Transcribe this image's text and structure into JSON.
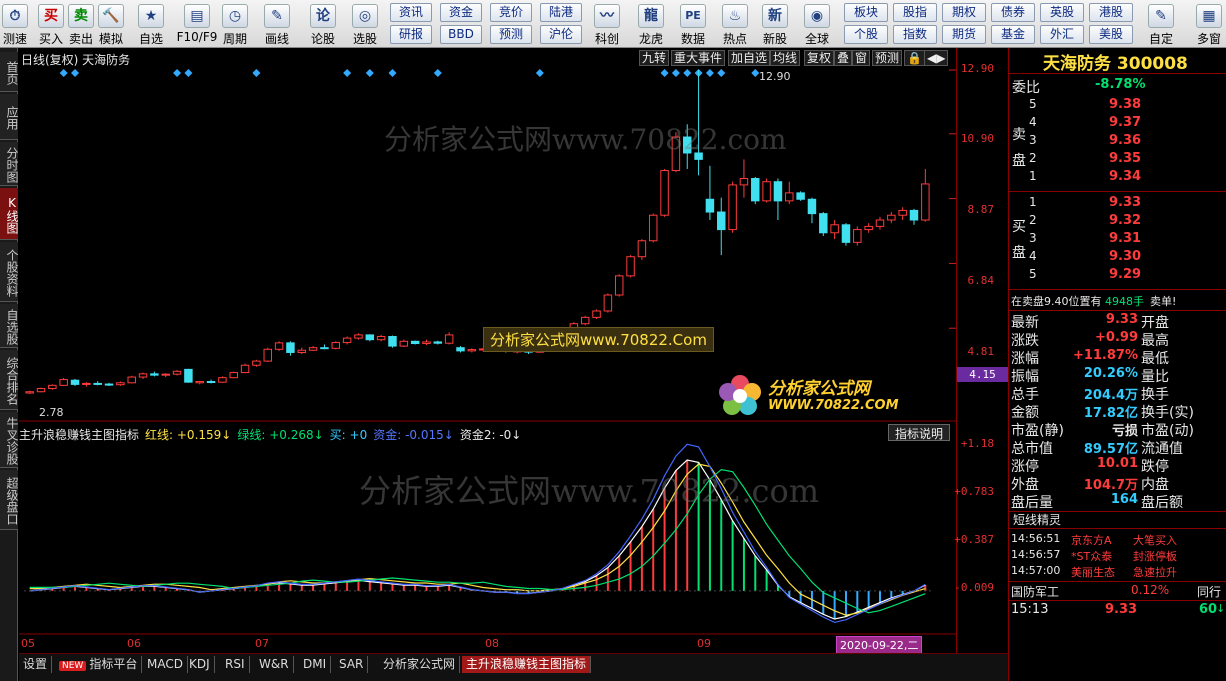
{
  "toolbar": {
    "items": [
      {
        "label": "测速",
        "icon": "speed-icon",
        "glyph": "⏱"
      },
      {
        "label": "买入",
        "icon": "buy-icon",
        "glyph": "买"
      },
      {
        "label": "卖出",
        "icon": "sell-icon",
        "glyph": "卖"
      },
      {
        "label": "模拟",
        "icon": "hammer-icon",
        "glyph": "🔨"
      },
      {
        "label": "自选",
        "icon": "star-icon",
        "glyph": "★"
      },
      {
        "label": "F10/F9",
        "icon": "f10-icon",
        "glyph": "▤"
      },
      {
        "label": "周期",
        "icon": "clock-icon",
        "glyph": "◷"
      },
      {
        "label": "画线",
        "icon": "pen-icon",
        "glyph": "✎"
      },
      {
        "label": "论股",
        "icon": "discuss-icon",
        "glyph": "论"
      },
      {
        "label": "选股",
        "icon": "select-icon",
        "glyph": "◎"
      }
    ],
    "group1": [
      [
        "资讯",
        "资金",
        "竞价",
        "陆港"
      ],
      [
        "研报",
        "BBD",
        "预测",
        "沪伦"
      ]
    ],
    "items2": [
      {
        "label": "科创",
        "icon": "chart-icon",
        "glyph": "〰"
      },
      {
        "label": "龙虎",
        "icon": "dragon-icon",
        "glyph": "龍"
      },
      {
        "label": "数据",
        "icon": "pe-icon",
        "glyph": "PE"
      },
      {
        "label": "热点",
        "icon": "fire-icon",
        "glyph": "♨"
      },
      {
        "label": "新股",
        "icon": "new-stock-icon",
        "glyph": "新"
      },
      {
        "label": "全球",
        "icon": "globe-icon",
        "glyph": "◉"
      }
    ],
    "group2": [
      [
        "板块",
        "股指",
        "期权",
        "债券",
        "英股",
        "港股"
      ],
      [
        "个股",
        "指数",
        "期货",
        "基金",
        "外汇",
        "美股"
      ]
    ],
    "items3": [
      {
        "label": "自定",
        "icon": "custom-icon",
        "glyph": "✎"
      },
      {
        "label": "多窗",
        "icon": "multiwin-icon",
        "glyph": "▦"
      }
    ]
  },
  "leftnav": [
    "首页",
    "应用",
    "分时图",
    "K线图",
    "个股资料",
    "自选股",
    "综合排名",
    "牛叉诊股",
    "超级盘口"
  ],
  "chart": {
    "header": "日线(复权) 天海防务",
    "top_buttons": [
      "九转",
      "重大事件",
      "加自选",
      "均线",
      "复权",
      "叠",
      "窗",
      "预测"
    ],
    "high_label": "12.90",
    "low_label": "2.78",
    "indicator_line": [
      {
        "text": "主升浪稳赚钱主图指标",
        "color": "#e8e8e8"
      },
      {
        "text": "红线: +0.159↓",
        "color": "#ffe044"
      },
      {
        "text": "绿线: +0.268↓",
        "color": "#00e070"
      },
      {
        "text": "买: +0",
        "color": "#33ccff"
      },
      {
        "text": "资金: -0.015↓",
        "color": "#5577ff"
      },
      {
        "text": "资金2: -0↓",
        "color": "#e8e8e8"
      }
    ],
    "indicator_help": "指标说明",
    "watermark": "分析家公式网www.70822.com",
    "banner": "分析家公式网www.70822.Com",
    "logo_text": "分析家公式网",
    "logo_url": "WWW.70822.COM",
    "date_labels": [
      "05",
      "06",
      "07",
      "08",
      "09"
    ],
    "crosshair_date": "2020-09-22,二",
    "price_axis": [
      "12.90",
      "10.90",
      "8.87",
      "6.84",
      "4.81",
      "4.15"
    ],
    "ind_axis": [
      "+1.18",
      "+0.783",
      "+0.387",
      "-0.009"
    ]
  },
  "right": {
    "title": "天海防务 300008",
    "weibi_label": "委比",
    "weibi": "-8.78%",
    "sell_label": "卖盘",
    "buy_label": "买盘",
    "sells": [
      [
        "5",
        "9.38"
      ],
      [
        "4",
        "9.37"
      ],
      [
        "3",
        "9.36"
      ],
      [
        "2",
        "9.35"
      ],
      [
        "1",
        "9.34"
      ]
    ],
    "buys": [
      [
        "1",
        "9.33"
      ],
      [
        "2",
        "9.32"
      ],
      [
        "3",
        "9.31"
      ],
      [
        "4",
        "9.30"
      ],
      [
        "5",
        "9.29"
      ]
    ],
    "notice": "在卖盘9.40位置有",
    "notice_val": "4948手",
    "notice_tail": "卖单!",
    "stats": [
      [
        "最新",
        "9.33",
        "开盘"
      ],
      [
        "涨跌",
        "+0.99",
        "最高"
      ],
      [
        "涨幅",
        "+11.87%",
        "最低"
      ],
      [
        "振幅",
        "20.26%",
        "量比"
      ],
      [
        "总手",
        "204.4万",
        "换手"
      ],
      [
        "金额",
        "17.82亿",
        "换手(实)"
      ],
      [
        "市盈(静)",
        "亏损",
        "市盈(动)"
      ],
      [
        "总市值",
        "89.57亿",
        "流通值"
      ],
      [
        "涨停",
        "10.01",
        "跌停"
      ],
      [
        "外盘",
        "104.7万",
        "内盘"
      ],
      [
        "盘后量",
        "164",
        "盘后额"
      ]
    ],
    "jingling_title": "短线精灵",
    "jingling": [
      [
        "14:56:51",
        "京东方A",
        "大笔买入"
      ],
      [
        "14:56:57",
        "*ST众泰",
        "封涨停板"
      ],
      [
        "14:57:00",
        "美丽生态",
        "急速拉升"
      ]
    ],
    "sector": "国防军工",
    "sector_pct": "0.12%",
    "sector_tail": "同行",
    "last_time": "15:13",
    "last_price": "9.33",
    "last_vol": "60"
  },
  "bottom_tabs": [
    "设置",
    "指标平台",
    "MACD",
    "KDJ",
    "RSI",
    "W&R",
    "DMI",
    "SAR",
    "分析家公式网",
    "主升浪稳赚钱主图指标"
  ],
  "new_badge": "NEW",
  "chart_data": {
    "type": "candlestick",
    "candles": [
      [
        2.78,
        2.85,
        2.75,
        2.82
      ],
      [
        2.82,
        2.95,
        2.8,
        2.92
      ],
      [
        2.92,
        3.05,
        2.88,
        3.02
      ],
      [
        3.02,
        3.25,
        3.0,
        3.2
      ],
      [
        3.18,
        3.22,
        3.0,
        3.05
      ],
      [
        3.05,
        3.12,
        2.98,
        3.08
      ],
      [
        3.08,
        3.15,
        3.02,
        3.06
      ],
      [
        3.06,
        3.1,
        3.0,
        3.03
      ],
      [
        3.04,
        3.14,
        3.0,
        3.1
      ],
      [
        3.1,
        3.32,
        3.08,
        3.28
      ],
      [
        3.28,
        3.42,
        3.22,
        3.38
      ],
      [
        3.38,
        3.45,
        3.3,
        3.34
      ],
      [
        3.34,
        3.4,
        3.28,
        3.37
      ],
      [
        3.37,
        3.5,
        3.33,
        3.46
      ],
      [
        3.52,
        3.54,
        3.1,
        3.12
      ],
      [
        3.1,
        3.16,
        3.05,
        3.14
      ],
      [
        3.14,
        3.2,
        3.08,
        3.12
      ],
      [
        3.12,
        3.3,
        3.1,
        3.26
      ],
      [
        3.26,
        3.45,
        3.24,
        3.42
      ],
      [
        3.42,
        3.7,
        3.4,
        3.65
      ],
      [
        3.65,
        3.82,
        3.6,
        3.78
      ],
      [
        3.78,
        4.2,
        3.75,
        4.15
      ],
      [
        4.15,
        4.4,
        4.1,
        4.35
      ],
      [
        4.35,
        4.4,
        3.95,
        4.05
      ],
      [
        4.05,
        4.2,
        4.0,
        4.12
      ],
      [
        4.12,
        4.25,
        4.1,
        4.2
      ],
      [
        4.2,
        4.3,
        4.15,
        4.18
      ],
      [
        4.18,
        4.4,
        4.15,
        4.36
      ],
      [
        4.36,
        4.55,
        4.3,
        4.5
      ],
      [
        4.5,
        4.65,
        4.45,
        4.6
      ],
      [
        4.6,
        4.62,
        4.4,
        4.45
      ],
      [
        4.45,
        4.6,
        4.4,
        4.55
      ],
      [
        4.55,
        4.58,
        4.2,
        4.25
      ],
      [
        4.25,
        4.45,
        4.22,
        4.4
      ],
      [
        4.4,
        4.42,
        4.3,
        4.33
      ],
      [
        4.33,
        4.45,
        4.28,
        4.38
      ],
      [
        4.38,
        4.42,
        4.3,
        4.34
      ],
      [
        4.34,
        4.68,
        4.3,
        4.6
      ],
      [
        4.2,
        4.25,
        4.05,
        4.1
      ],
      [
        4.1,
        4.18,
        4.05,
        4.14
      ],
      [
        4.14,
        4.2,
        4.08,
        4.16
      ],
      [
        4.16,
        4.22,
        4.1,
        4.12
      ],
      [
        4.12,
        4.18,
        4.05,
        4.08
      ],
      [
        4.08,
        4.14,
        4.02,
        4.1
      ],
      [
        4.1,
        4.15,
        4.0,
        4.06
      ],
      [
        4.06,
        4.3,
        4.04,
        4.25
      ],
      [
        4.25,
        4.55,
        4.2,
        4.5
      ],
      [
        4.5,
        4.75,
        4.45,
        4.7
      ],
      [
        4.7,
        5.0,
        4.65,
        4.95
      ],
      [
        4.95,
        5.2,
        4.9,
        5.15
      ],
      [
        5.15,
        5.4,
        5.1,
        5.35
      ],
      [
        5.35,
        5.9,
        5.3,
        5.85
      ],
      [
        5.85,
        6.5,
        5.8,
        6.45
      ],
      [
        6.45,
        7.1,
        6.4,
        7.05
      ],
      [
        7.05,
        7.6,
        6.95,
        7.55
      ],
      [
        7.55,
        8.4,
        7.5,
        8.35
      ],
      [
        8.35,
        9.8,
        8.3,
        9.75
      ],
      [
        9.75,
        10.95,
        9.7,
        10.8
      ],
      [
        10.8,
        11.2,
        9.8,
        10.3
      ],
      [
        10.3,
        12.9,
        9.6,
        10.1
      ],
      [
        8.85,
        9.9,
        8.2,
        8.45
      ],
      [
        8.45,
        8.9,
        7.1,
        7.9
      ],
      [
        7.9,
        9.4,
        7.8,
        9.3
      ],
      [
        9.3,
        10.1,
        8.9,
        9.5
      ],
      [
        9.5,
        9.55,
        8.7,
        8.8
      ],
      [
        8.8,
        9.5,
        8.75,
        9.4
      ],
      [
        9.4,
        9.5,
        8.2,
        8.8
      ],
      [
        8.8,
        9.4,
        8.7,
        9.05
      ],
      [
        9.05,
        9.1,
        8.8,
        8.85
      ],
      [
        8.85,
        8.9,
        8.1,
        8.4
      ],
      [
        8.4,
        8.45,
        7.7,
        7.8
      ],
      [
        7.8,
        8.2,
        7.6,
        8.05
      ],
      [
        8.05,
        8.1,
        7.4,
        7.5
      ],
      [
        7.5,
        8.0,
        7.4,
        7.9
      ],
      [
        7.9,
        8.1,
        7.8,
        8.0
      ],
      [
        8.0,
        8.3,
        7.9,
        8.2
      ],
      [
        8.2,
        8.45,
        8.1,
        8.35
      ],
      [
        8.35,
        8.6,
        8.2,
        8.5
      ],
      [
        8.5,
        8.55,
        8.05,
        8.2
      ],
      [
        8.2,
        9.8,
        8.15,
        9.33
      ]
    ],
    "oscillator": [
      0.0,
      0.01,
      0.02,
      0.03,
      0.04,
      0.03,
      0.02,
      0.01,
      0.02,
      0.03,
      0.04,
      0.04,
      0.03,
      0.02,
      0.01,
      -0.01,
      0.0,
      0.01,
      0.02,
      0.03,
      0.04,
      0.06,
      0.07,
      0.06,
      0.05,
      0.05,
      0.06,
      0.07,
      0.08,
      0.09,
      0.08,
      0.07,
      0.06,
      0.05,
      0.05,
      0.04,
      0.04,
      0.05,
      0.03,
      0.01,
      0.0,
      -0.01,
      -0.01,
      -0.02,
      -0.02,
      -0.01,
      0.0,
      0.02,
      0.05,
      0.08,
      0.13,
      0.2,
      0.3,
      0.42,
      0.55,
      0.7,
      0.88,
      1.03,
      1.12,
      1.1,
      0.95,
      0.78,
      0.6,
      0.45,
      0.3,
      0.18,
      0.05,
      -0.05,
      -0.1,
      -0.15,
      -0.2,
      -0.24,
      -0.22,
      -0.18,
      -0.14,
      -0.1,
      -0.06,
      -0.03,
      0.0,
      0.05
    ],
    "series": [
      {
        "color": "#ffffff"
      },
      {
        "color": "#ffe044"
      },
      {
        "color": "#00e070"
      },
      {
        "color": "#4466ff"
      }
    ],
    "ylim": [
      2.78,
      12.9
    ],
    "ind_ylim": [
      -0.3,
      1.18
    ]
  }
}
